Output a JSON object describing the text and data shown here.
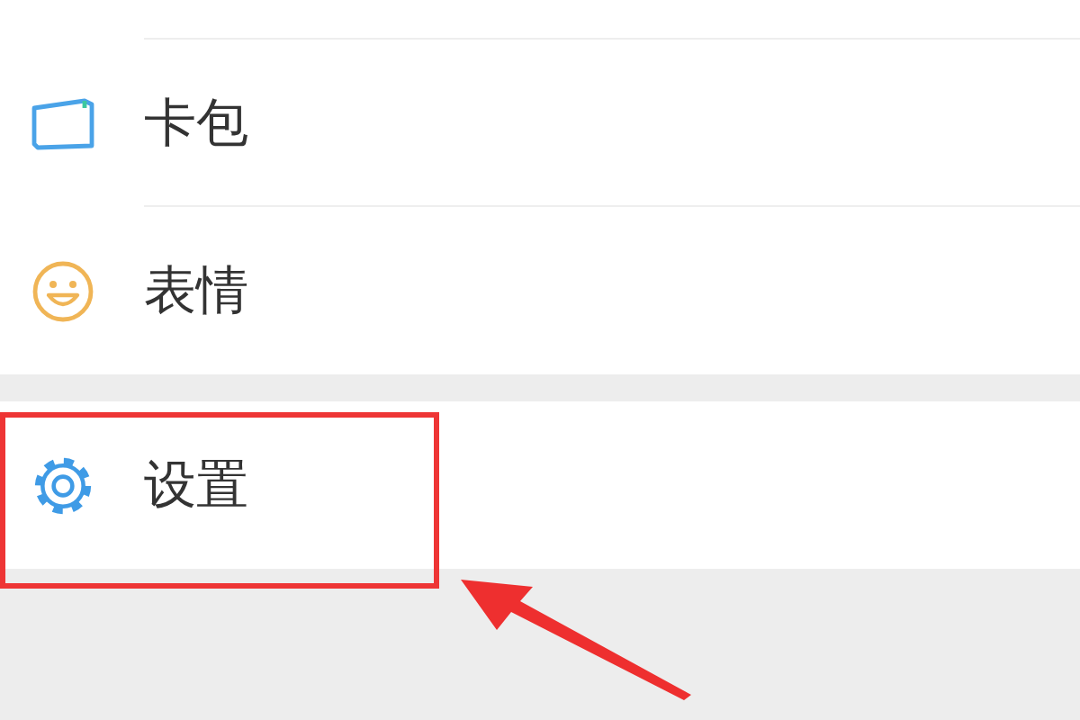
{
  "sections": [
    {
      "items": [
        {
          "label": "卡包",
          "kind": "wallet",
          "highlighted": false
        },
        {
          "label": "表情",
          "kind": "emoji",
          "highlighted": false
        }
      ]
    },
    {
      "items": [
        {
          "label": "设置",
          "kind": "settings",
          "highlighted": true
        }
      ]
    }
  ]
}
